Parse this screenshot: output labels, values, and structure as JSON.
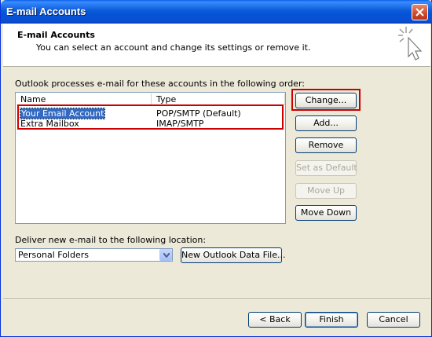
{
  "window": {
    "title": "E-mail Accounts"
  },
  "header": {
    "title": "E-mail Accounts",
    "subtitle": "You can select an account and change its settings or remove it."
  },
  "accounts_section": {
    "label": "Outlook processes e-mail for these accounts in the following order:",
    "columns": [
      "Name",
      "Type"
    ],
    "rows": [
      {
        "name": "Your Email Account",
        "type": "POP/SMTP (Default)",
        "selected": true
      },
      {
        "name": "Extra Mailbox",
        "type": "IMAP/SMTP",
        "selected": false
      }
    ]
  },
  "side_buttons": {
    "change": "Change...",
    "add": "Add...",
    "remove": "Remove",
    "set_default": "Set as Default",
    "move_up": "Move Up",
    "move_down": "Move Down"
  },
  "delivery": {
    "label": "Deliver new e-mail to the following location:",
    "selected": "Personal Folders",
    "new_data_file": "New Outlook Data File..."
  },
  "footer": {
    "back": "< Back",
    "finish": "Finish",
    "cancel": "Cancel"
  },
  "colors": {
    "highlight": "#cc0000",
    "selection": "#316ac5",
    "titlebar": "#0453d6"
  }
}
